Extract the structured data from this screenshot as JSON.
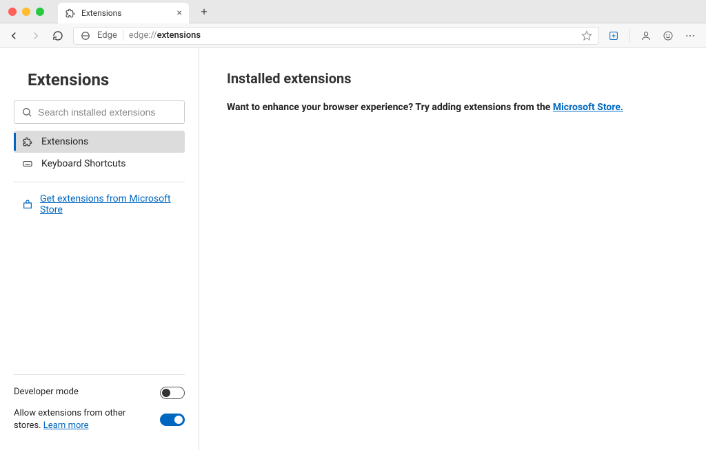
{
  "chrome": {
    "tab_title": "Extensions",
    "address_label": "Edge",
    "address_prefix": "edge://",
    "address_path_strong": "extensions"
  },
  "sidebar": {
    "title": "Extensions",
    "search_placeholder": "Search installed extensions",
    "items": [
      {
        "label": "Extensions",
        "active": true
      },
      {
        "label": "Keyboard Shortcuts",
        "active": false
      }
    ],
    "store_link": "Get extensions from Microsoft Store",
    "developer_mode_label": "Developer mode",
    "developer_mode_on": false,
    "allow_other_stores_label": "Allow extensions from other stores. ",
    "allow_other_stores_learn_more": "Learn more",
    "allow_other_stores_on": true
  },
  "main": {
    "heading": "Installed extensions",
    "enhance_text_prefix": "Want to enhance your browser experience? Try adding extensions from the ",
    "enhance_link": "Microsoft Store."
  },
  "colors": {
    "accent": "#0067c0"
  }
}
